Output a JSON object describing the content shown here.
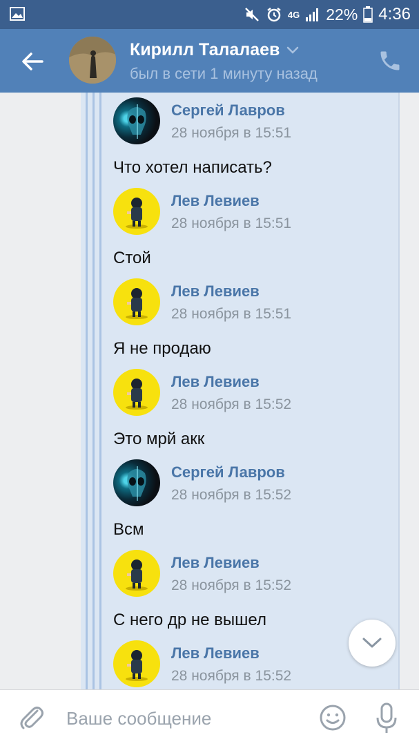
{
  "status_bar": {
    "network": "4G",
    "battery": "22%",
    "time": "4:36"
  },
  "header": {
    "name": "Кирилл Талалаев",
    "status": "был в сети 1 минуту назад"
  },
  "messages": [
    {
      "author": "Сергей Лавров",
      "date": "28 ноября в 15:51",
      "text": "Что хотел написать?",
      "avatar": "skull-avatar"
    },
    {
      "author": "Лев Левиев",
      "date": "28 ноября в 15:51",
      "text": "Стой",
      "avatar": "yellow-avatar"
    },
    {
      "author": "Лев Левиев",
      "date": "28 ноября в 15:51",
      "text": "Я не продаю",
      "avatar": "yellow-avatar"
    },
    {
      "author": "Лев Левиев",
      "date": "28 ноября в 15:52",
      "text": "Это мрй акк",
      "avatar": "yellow-avatar"
    },
    {
      "author": "Сергей Лавров",
      "date": "28 ноября в 15:52",
      "text": "Всм",
      "avatar": "skull-avatar"
    },
    {
      "author": "Лев Левиев",
      "date": "28 ноября в 15:52",
      "text": "С него др не вышел",
      "avatar": "yellow-avatar"
    },
    {
      "author": "Лев Левиев",
      "date": "28 ноября в 15:52",
      "text": "",
      "avatar": "yellow-avatar"
    }
  ],
  "input": {
    "placeholder": "Ваше сообщение"
  },
  "colors": {
    "header": "#5181b8",
    "status_bar": "#3b5f8e",
    "author": "#4a76a8",
    "forward_box": "#dbe6f3"
  }
}
